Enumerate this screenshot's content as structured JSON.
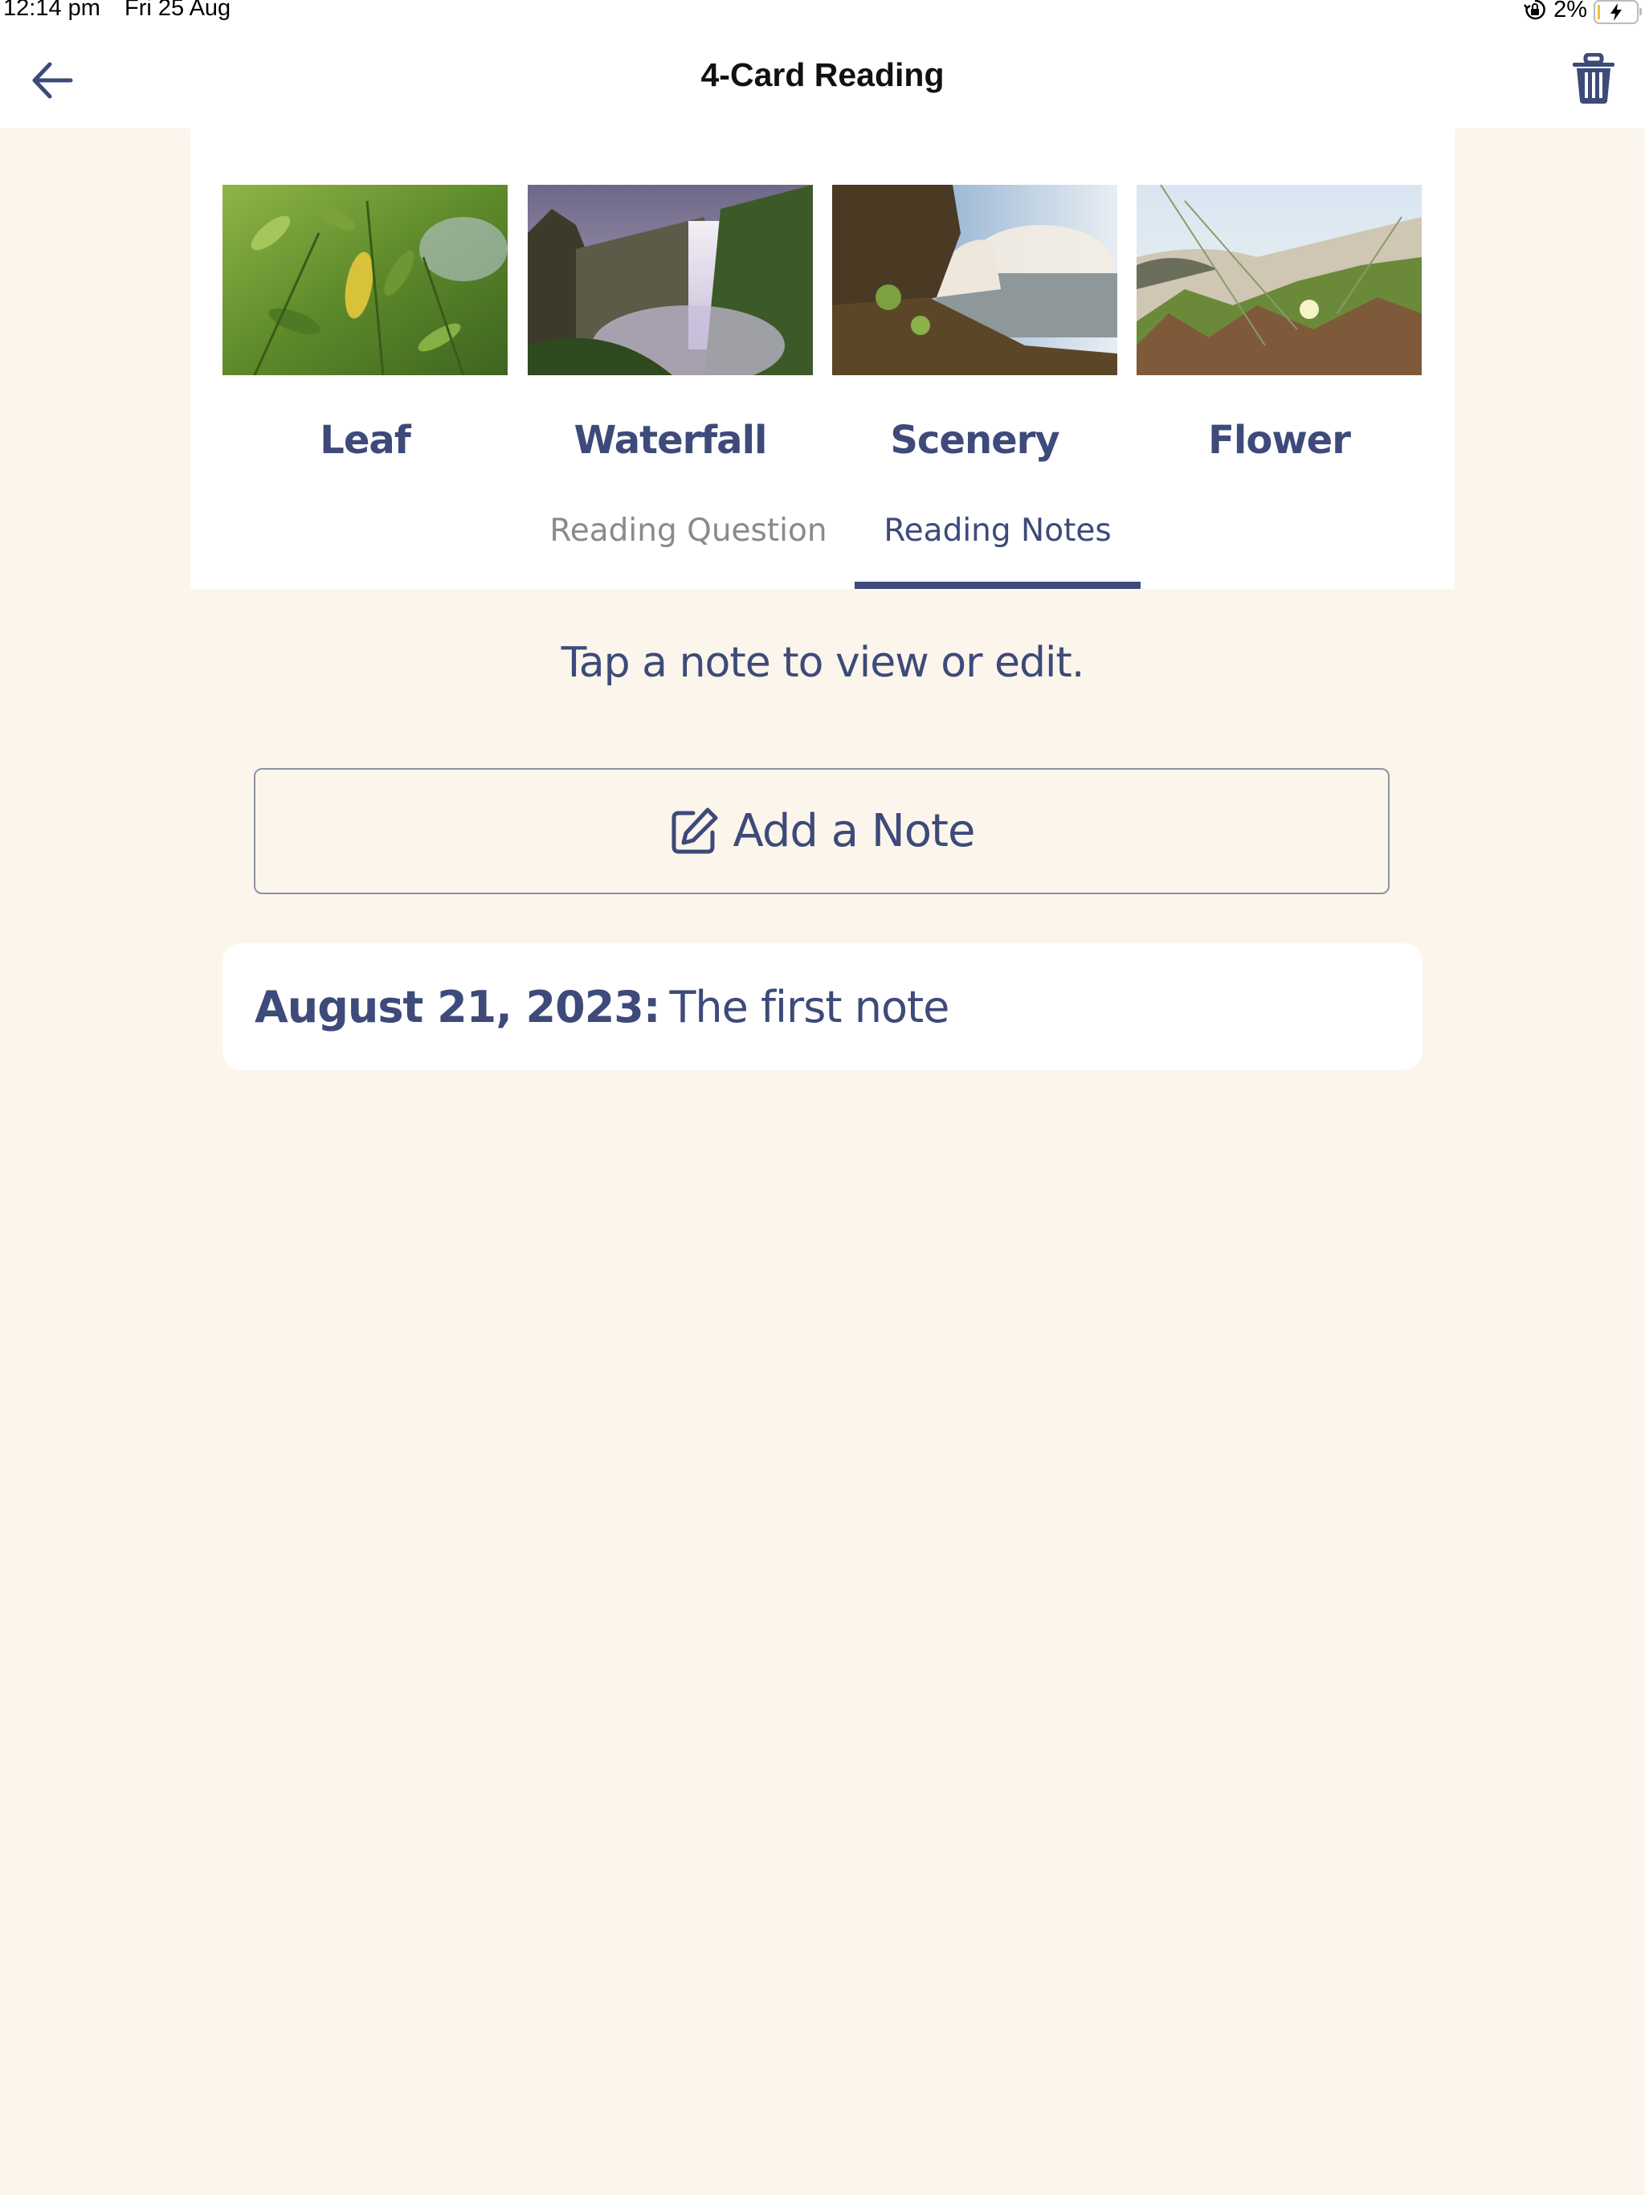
{
  "status_bar": {
    "time": "12:14 pm",
    "date": "Fri 25 Aug",
    "battery_percent": "2%",
    "icons": [
      "orientation-lock-icon",
      "battery-charging-icon"
    ]
  },
  "nav": {
    "title": "4-Card Reading",
    "back_icon": "arrow-left-icon",
    "delete_icon": "trash-icon"
  },
  "cards": [
    {
      "label": "Leaf",
      "image": "leaf-photo"
    },
    {
      "label": "Waterfall",
      "image": "waterfall-photo"
    },
    {
      "label": "Scenery",
      "image": "scenery-photo"
    },
    {
      "label": "Flower",
      "image": "flower-photo"
    }
  ],
  "tabs": [
    {
      "label": "Reading Question",
      "active": false
    },
    {
      "label": "Reading Notes",
      "active": true
    }
  ],
  "notes_section": {
    "instruction": "Tap a note to view or edit.",
    "add_button_label": "Add a Note",
    "add_button_icon": "edit-note-icon",
    "notes": [
      {
        "date": "August 21, 2023:",
        "text": "The first note"
      }
    ]
  },
  "colors": {
    "accent": "#3D4A7A",
    "background": "#FBF5EB",
    "inactive_tab": "#8A8A8E"
  }
}
